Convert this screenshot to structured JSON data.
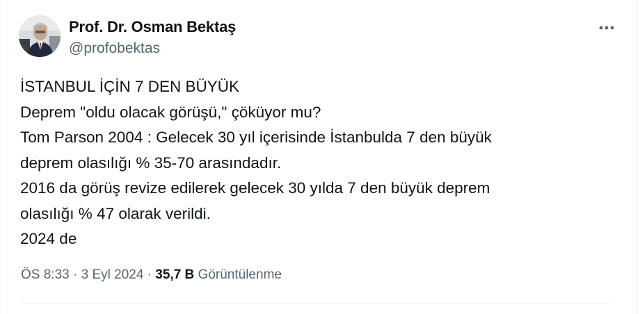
{
  "author": {
    "display_name": "Prof. Dr. Osman Bektaş",
    "handle": "@profobektas",
    "avatar_icon": "profile-photo"
  },
  "menu": {
    "more_icon": "ellipsis-icon"
  },
  "tweet": {
    "lines": [
      "İSTANBUL İÇİN 7 DEN BÜYÜK",
      "Deprem \"oldu olacak görüşü,\" çöküyor mu?",
      "Tom Parson 2004 : Gelecek 30 yıl içerisinde İstanbulda 7 den büyük",
      "deprem olasılığı % 35-70 arasındadır.",
      "2016 da görüş revize edilerek gelecek 30 yılda 7 den büyük deprem",
      "olasılığı % 47 olarak verildi.",
      "2024 de"
    ]
  },
  "meta": {
    "time": "ÖS 8:33",
    "separator": "·",
    "date": "3 Eyl 2024",
    "views_count": "35,7 B",
    "views_label": "Görüntülenme"
  },
  "colors": {
    "text": "#0f1419",
    "secondary": "#536471",
    "border": "#eff3f4"
  }
}
